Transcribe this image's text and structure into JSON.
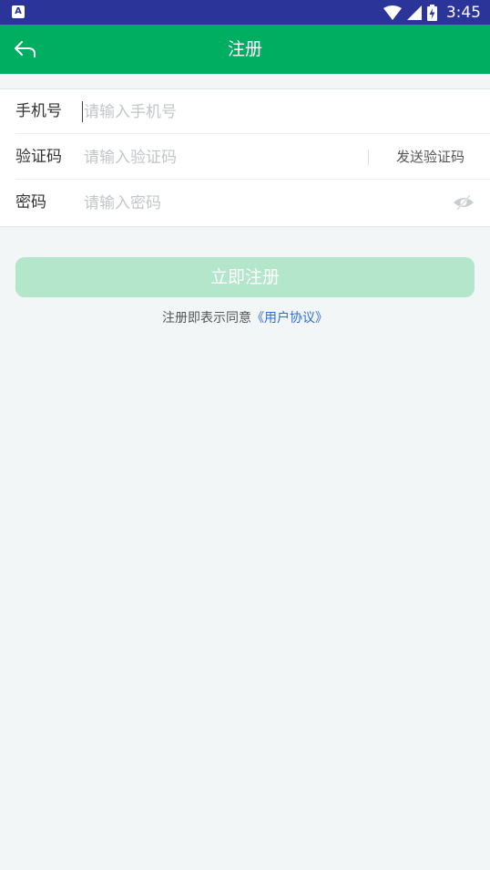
{
  "status_bar": {
    "notification_icon": "A",
    "time": "3:45",
    "icons": [
      "wifi-icon",
      "cell-signal-icon",
      "battery-charging-icon"
    ]
  },
  "app_bar": {
    "title": "注册",
    "back_icon": "back-arrow-icon",
    "background_color": "#00ae62"
  },
  "form": {
    "phone": {
      "label": "手机号",
      "placeholder": "请输入手机号",
      "value": ""
    },
    "code": {
      "label": "验证码",
      "placeholder": "请输入验证码",
      "value": "",
      "send_label": "发送验证码"
    },
    "password": {
      "label": "密码",
      "placeholder": "请输入密码",
      "value": "",
      "visibility_icon": "eye-off-icon"
    }
  },
  "register_button": {
    "label": "立即注册",
    "color": "#b3e6cb"
  },
  "agreement": {
    "prefix": "注册即表示同意",
    "link": "《用户协议》",
    "link_color": "#2d6fd1"
  }
}
